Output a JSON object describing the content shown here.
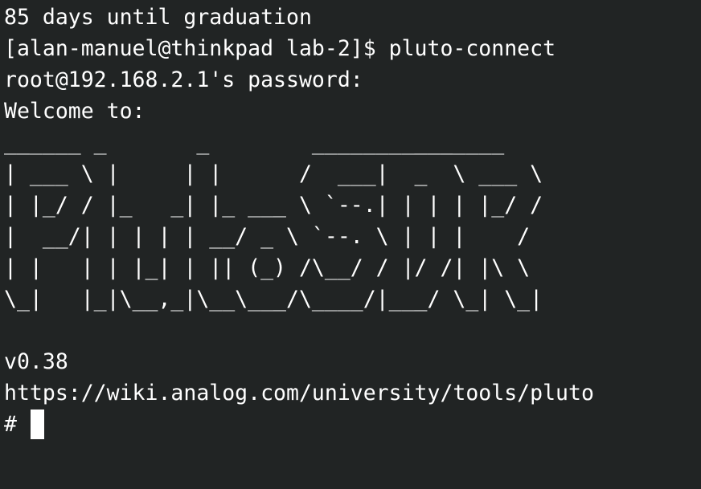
{
  "terminal": {
    "lines": [
      "85 days until graduation",
      "[alan-manuel@thinkpad lab-2]$ pluto-connect",
      "root@192.168.2.1's password:",
      "Welcome to:",
      "______ _       _        _______________",
      "| ___ \\ |     | |      /  ___|  _  \\ ___ \\",
      "| |_/ / |_   _| |_ ___ \\ `--.| | | | |_/ /",
      "|  __/| | | | | __/ _ \\ `--. \\ | | |    /",
      "| |   | | |_| | || (_) /\\__/ / |/ /| |\\ \\",
      "\\_|   |_|\\__,_|\\__\\___/\\____/|___/ \\_| \\_|",
      "",
      "v0.38",
      "https://wiki.analog.com/university/tools/pluto"
    ],
    "prompt": "# "
  }
}
